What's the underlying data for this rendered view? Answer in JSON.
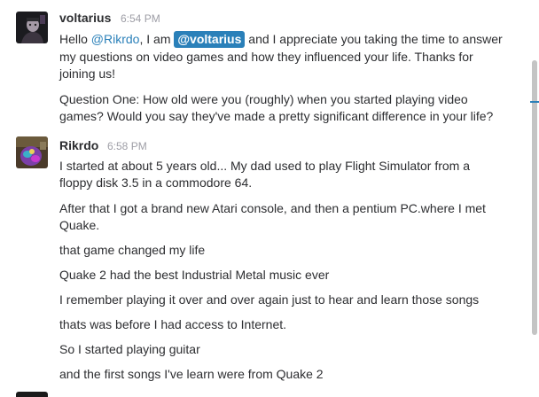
{
  "messages": [
    {
      "username": "voltarius",
      "time": "6:54 PM",
      "lines": [
        {
          "pre": "Hello ",
          "mention_link": "@Rikrdo",
          "mid": ", I am ",
          "mention_self": "@voltarius",
          "post": " and I appreciate you taking the time to answer"
        },
        "my questions on video games and how they influenced your life. Thanks for",
        "joining us!",
        "Question One: How old were you (roughly) when you started playing video",
        "games? Would you say they've made a pretty significant difference in your life?"
      ]
    },
    {
      "username": "Rikrdo",
      "time": "6:58 PM",
      "lines": [
        "I started at about 5 years old... My dad used to play Flight Simulator from a",
        "floppy disk 3.5 in a commodore 64.",
        "After that I got a brand new Atari console, and then a pentium PC.where I met",
        "Quake.",
        "that game changed my life",
        "Quake 2 had the best Industrial Metal music ever",
        "I remember playing it over and over again just to hear and learn those songs",
        "thats was before I had access to Internet.",
        "So I started playing guitar",
        "and the first songs I've learn were from Quake 2"
      ]
    }
  ],
  "colors": {
    "mention": "#2a80b9",
    "timestamp": "#9e9ea6",
    "text": "#2c2d30"
  }
}
